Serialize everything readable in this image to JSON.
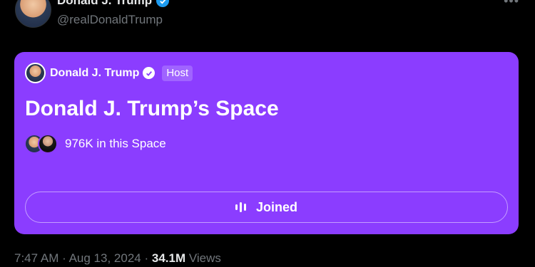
{
  "author": {
    "name": "Donald J. Trump",
    "handle": "@realDonaldTrump"
  },
  "space": {
    "host_name": "Donald J. Trump",
    "host_badge": "Host",
    "title": "Donald J. Trump’s Space",
    "listeners": "976K in this Space",
    "button_label": "Joined",
    "accent_color": "#8b3dff"
  },
  "meta": {
    "time": "7:47 AM",
    "separator": "·",
    "date": "Aug 13, 2024",
    "views_count": "34.1M",
    "views_label": "Views"
  },
  "icons": [
    "verified-badge-icon",
    "more-icon",
    "audio-wave-icon"
  ]
}
